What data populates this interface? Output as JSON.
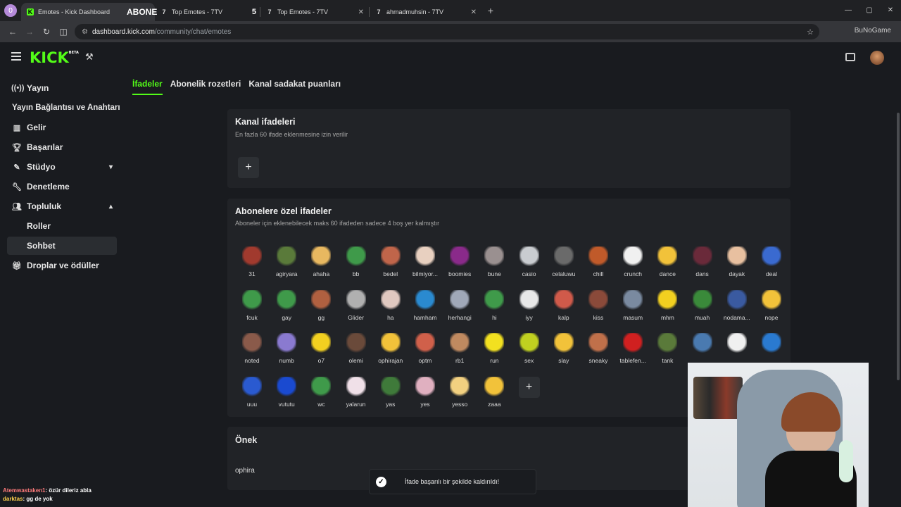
{
  "browser": {
    "profile_initial": "0",
    "tabs": [
      {
        "title": "Emotes - Kick Dashboard",
        "icon": "kick-icon",
        "active": true
      },
      {
        "title": "Top Emotes - 7TV",
        "icon": "7tv-icon",
        "active": false,
        "overlay": "ABONE",
        "badge": "5"
      },
      {
        "title": "Top Emotes - 7TV",
        "icon": "7tv-icon",
        "active": false
      },
      {
        "title": "ahmadmuhsin - 7TV",
        "icon": "7tv-icon",
        "active": false
      }
    ],
    "url_host": "dashboard.kick.com",
    "url_path": "/community/chat/emotes",
    "ext_label": "BuNoGame"
  },
  "header": {
    "logo": "KICK",
    "logo_badge": "BETA"
  },
  "sidebar": {
    "items": [
      {
        "label": "Yayın",
        "icon": "broadcast-icon"
      },
      {
        "label": "Yayın Bağlantısı ve Anahtarı",
        "icon": ""
      },
      {
        "label": "Gelir",
        "icon": "chart-icon"
      },
      {
        "label": "Başarılar",
        "icon": "trophy-icon"
      },
      {
        "label": "Stüdyo",
        "icon": "brush-icon",
        "chevron": "down"
      },
      {
        "label": "Denetleme",
        "icon": "wrench-icon"
      },
      {
        "label": "Topluluk",
        "icon": "people-icon",
        "chevron": "up"
      },
      {
        "label": "Roller",
        "icon": ""
      },
      {
        "label": "Sohbet",
        "icon": "",
        "active": true
      },
      {
        "label": "Droplar ve ödüller",
        "icon": "gift-icon"
      }
    ]
  },
  "tabs": [
    {
      "label": "İfadeler",
      "active": true
    },
    {
      "label": "Abonelik rozetleri",
      "active": false
    },
    {
      "label": "Kanal sadakat puanları",
      "active": false
    }
  ],
  "channel_emotes": {
    "title": "Kanal ifadeleri",
    "subtitle": "En fazla 60 ifade eklenmesine izin verilir",
    "add_label": "+"
  },
  "sub_emotes": {
    "title": "Abonelere özel ifadeler",
    "subtitle": "Aboneler için eklenebilecek maks 60 ifadeden sadece 4 boş yer kalmıştır",
    "add_label": "+",
    "emotes": [
      {
        "name": "31",
        "color": "#a13a2e"
      },
      {
        "name": "agiryara",
        "color": "#5a7a3a"
      },
      {
        "name": "ahaha",
        "color": "#e8b860"
      },
      {
        "name": "bb",
        "color": "#3f9a4a"
      },
      {
        "name": "bedel",
        "color": "#c0654a"
      },
      {
        "name": "bilmiyor...",
        "color": "#e8d0c0"
      },
      {
        "name": "boomies",
        "color": "#8a2a8a"
      },
      {
        "name": "bune",
        "color": "#9a9090"
      },
      {
        "name": "casio",
        "color": "#c9ccd0"
      },
      {
        "name": "celaluwu",
        "color": "#6a6a6a"
      },
      {
        "name": "chill",
        "color": "#c05a2a"
      },
      {
        "name": "crunch",
        "color": "#f0f0f0"
      },
      {
        "name": "dance",
        "color": "#f2c23a"
      },
      {
        "name": "dans",
        "color": "#6a2a3a"
      },
      {
        "name": "dayak",
        "color": "#e8c0a0"
      },
      {
        "name": "deal",
        "color": "#3a6ad0"
      },
      {
        "name": "fcuk",
        "color": "#3f9a4a"
      },
      {
        "name": "gay",
        "color": "#3f9a4a"
      },
      {
        "name": "gg",
        "color": "#b06040"
      },
      {
        "name": "Glider",
        "color": "#b0b0b0"
      },
      {
        "name": "ha",
        "color": "#e0c8c0"
      },
      {
        "name": "hamham",
        "color": "#2a8ad0"
      },
      {
        "name": "herhangi",
        "color": "#a0a8b8"
      },
      {
        "name": "hi",
        "color": "#3f9a4a"
      },
      {
        "name": "iyy",
        "color": "#e8e8e8"
      },
      {
        "name": "kalp",
        "color": "#d05a4a"
      },
      {
        "name": "kiss",
        "color": "#8a4a3a"
      },
      {
        "name": "masum",
        "color": "#7a8aa0"
      },
      {
        "name": "mhm",
        "color": "#f2d020"
      },
      {
        "name": "muah",
        "color": "#3a8a3a"
      },
      {
        "name": "nodama...",
        "color": "#3a5aa0"
      },
      {
        "name": "nope",
        "color": "#f2c23a"
      },
      {
        "name": "noted",
        "color": "#8a5a4a"
      },
      {
        "name": "numb",
        "color": "#8a7ad0"
      },
      {
        "name": "o7",
        "color": "#f2d020"
      },
      {
        "name": "olemi",
        "color": "#6a4a3a"
      },
      {
        "name": "ophirajan",
        "color": "#f2c23a"
      },
      {
        "name": "optm",
        "color": "#d0604a"
      },
      {
        "name": "rb1",
        "color": "#c08a60"
      },
      {
        "name": "run",
        "color": "#f2e020"
      },
      {
        "name": "sex",
        "color": "#c0d020"
      },
      {
        "name": "slay",
        "color": "#f2c23a"
      },
      {
        "name": "sneaky",
        "color": "#c0704a"
      },
      {
        "name": "tablefen...",
        "color": "#d02020"
      },
      {
        "name": "tank",
        "color": "#5a7a3a"
      },
      {
        "name": "",
        "color": "#4a7ab0"
      },
      {
        "name": "",
        "color": "#f0f0f0"
      },
      {
        "name": "",
        "color": "#2a7ad0"
      },
      {
        "name": "uuu",
        "color": "#2a5ad0"
      },
      {
        "name": "vututu",
        "color": "#1a4ad0"
      },
      {
        "name": "wc",
        "color": "#3f9a4a"
      },
      {
        "name": "yalarun",
        "color": "#f0e0e8"
      },
      {
        "name": "yas",
        "color": "#3f7a3a"
      },
      {
        "name": "yes",
        "color": "#e0b0c0"
      },
      {
        "name": "yesso",
        "color": "#f2d080"
      },
      {
        "name": "zaaa",
        "color": "#f2c23a"
      }
    ]
  },
  "prefix": {
    "title": "Önek",
    "value": "ophira"
  },
  "toast": {
    "message": "İfade başarılı bir şekilde kaldırıldı!"
  },
  "chat_overlay": [
    {
      "user": "Atemwastaken1",
      "message": ": özür dileriz abla"
    },
    {
      "user": "darktas",
      "message": ": gg de yok"
    }
  ],
  "colors": {
    "accent": "#53fc18",
    "background": "#191b1f",
    "card": "#212327"
  }
}
